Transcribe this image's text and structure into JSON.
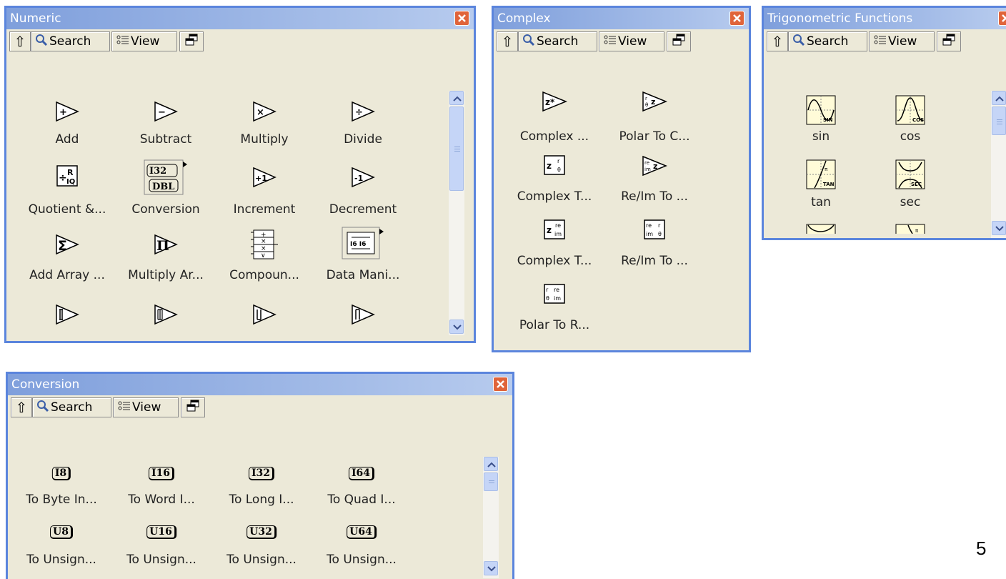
{
  "toolbar": {
    "up_glyph": "⇧",
    "search_label": "Search",
    "view_label": "View"
  },
  "numeric": {
    "title": "Numeric",
    "items": [
      "Add",
      "Subtract",
      "Multiply",
      "Divide",
      "Quotient &...",
      "Conversion",
      "Increment",
      "Decrement",
      "Add Array ...",
      "Multiply Ar...",
      "Compoun...",
      "Data Mani..."
    ],
    "glyphs": [
      "+",
      "−",
      "×",
      "÷",
      "",
      "",
      "+1",
      "-1",
      "Σ",
      "Π",
      "",
      ""
    ]
  },
  "complex": {
    "title": "Complex",
    "items": [
      "Complex ...",
      "Polar To C...",
      "Complex T...",
      "Re/Im To ...",
      "Complex T...",
      "Re/Im To ...",
      "Polar To R..."
    ],
    "glyphs": [
      "z*",
      "r θ z",
      "z r θ",
      "re im z",
      "z re im",
      "re r im θ",
      "r re θ im"
    ]
  },
  "trig": {
    "title": "Trigonometric Functions",
    "items": [
      "sin",
      "cos",
      "tan",
      "sec"
    ],
    "glyphs": [
      "SIN",
      "COS",
      "TAN",
      "SEC"
    ]
  },
  "conversion": {
    "title": "Conversion",
    "items": [
      "To Byte In...",
      "To Word I...",
      "To Long I...",
      "To Quad I..."
    ],
    "tags": [
      "I8",
      "I16",
      "I32",
      "I64",
      "U8",
      "U16",
      "U32",
      "U64"
    ],
    "partial_labels": [
      "To Unsign...",
      "To Unsign...",
      "To Unsign...",
      "To Unsign..."
    ]
  },
  "conversion_icon": {
    "top": "I32",
    "bottom": "DBL"
  },
  "data_manip_icon": {
    "text": "I6 I6"
  },
  "slide_number": "5"
}
